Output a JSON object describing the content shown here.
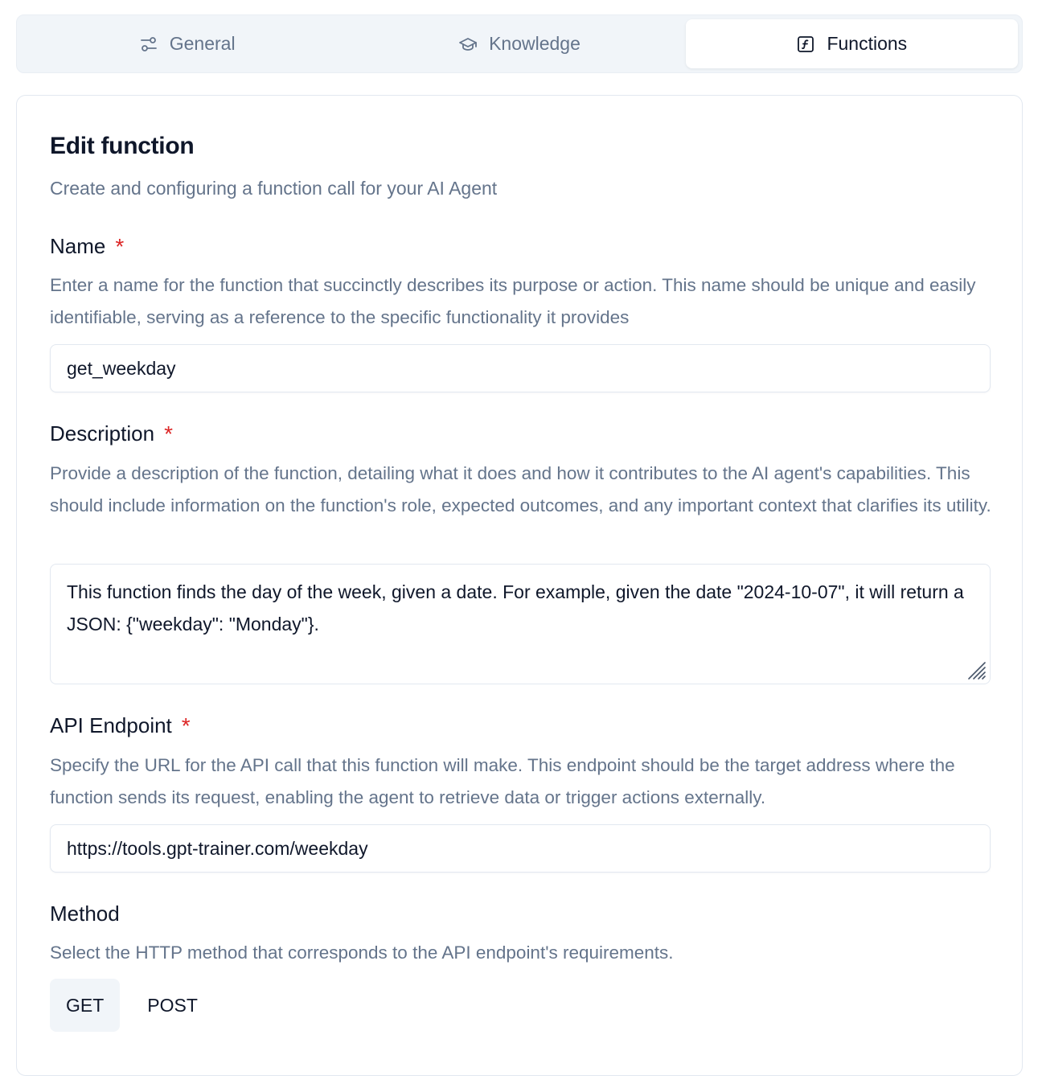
{
  "tabs": [
    {
      "label": "General",
      "icon": "sliders-icon",
      "active": false
    },
    {
      "label": "Knowledge",
      "icon": "graduation-cap-icon",
      "active": false
    },
    {
      "label": "Functions",
      "icon": "function-square-icon",
      "active": true
    }
  ],
  "form": {
    "title": "Edit function",
    "subtitle": "Create and configuring a function call for your AI Agent",
    "required_mark": "*",
    "name": {
      "label": "Name",
      "help": "Enter a name for the function that succinctly describes its purpose or action. This name should be unique and easily identifiable, serving as a reference to the specific functionality it provides",
      "value": "get_weekday"
    },
    "description": {
      "label": "Description",
      "help": "Provide a description of the function, detailing what it does and how it contributes to the AI agent's capabilities. This should include information on the function's role, expected outcomes, and any important context that clarifies its utility.",
      "value": "This function finds the day of the week, given a date. For example, given the date \"2024-10-07\", it will return a JSON: {\"weekday\": \"Monday\"}."
    },
    "endpoint": {
      "label": "API Endpoint",
      "help": "Specify the URL for the API call that this function will make. This endpoint should be the target address where the function sends its request, enabling the agent to retrieve data or trigger actions externally.",
      "value": "https://tools.gpt-trainer.com/weekday"
    },
    "method": {
      "label": "Method",
      "help": "Select the HTTP method that corresponds to the API endpoint's requirements.",
      "options": [
        "GET",
        "POST"
      ],
      "selected": "GET"
    }
  },
  "colors": {
    "required": "#dc2626",
    "muted_text": "#64748b",
    "tab_bg": "#f1f5f9"
  }
}
